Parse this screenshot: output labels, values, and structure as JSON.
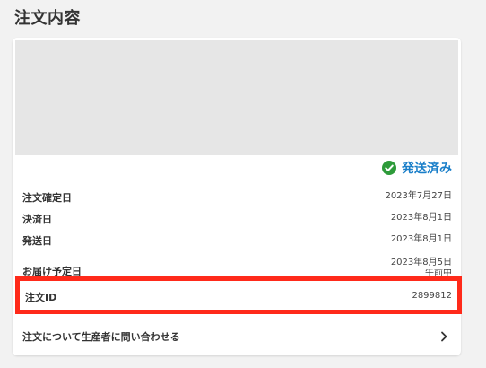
{
  "page": {
    "title": "注文内容"
  },
  "order": {
    "status_label": "発送済み",
    "status_icon": "check-circle-icon",
    "colors": {
      "status_text": "#1a7fc9",
      "status_icon": "#2e9b3a",
      "highlight_border": "#ff2a1a"
    },
    "details": [
      {
        "label": "注文確定日",
        "value": "2023年7月27日"
      },
      {
        "label": "決済日",
        "value": "2023年8月1日"
      },
      {
        "label": "発送日",
        "value": "2023年8月1日"
      },
      {
        "label": "お届け予定日",
        "value": "2023年8月5日",
        "note": "午前中"
      }
    ],
    "order_id": {
      "label": "注文ID",
      "value": "2899812"
    }
  },
  "contact": {
    "label": "注文について生産者に問い合わせる",
    "icon": "chevron-right-icon"
  }
}
